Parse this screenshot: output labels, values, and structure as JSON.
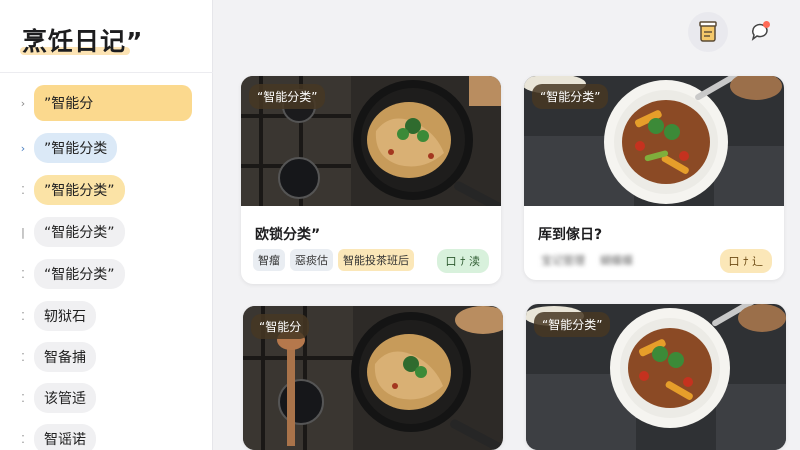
{
  "app": {
    "title": "烹饪日记”"
  },
  "sidebar": {
    "items": [
      {
        "label": "”智能分",
        "chev": "›",
        "style": "active"
      },
      {
        "label": "”智能分类",
        "chev": "›",
        "style": "blue"
      },
      {
        "label": "”智能分类”",
        "chev": "⁚",
        "style": "yellow"
      },
      {
        "label": "“智能分类”",
        "chev": "|",
        "style": "plain"
      },
      {
        "label": "“智能分类”",
        "chev": "⁚",
        "style": "plain"
      },
      {
        "label": "轫狱石",
        "chev": "⁚",
        "style": "plain"
      },
      {
        "label": "智备捕",
        "chev": "⁚",
        "style": "plain"
      },
      {
        "label": "该管适",
        "chev": "⁚",
        "style": "plain"
      },
      {
        "label": "智谣诺",
        "chev": "⁚",
        "style": "plain"
      }
    ]
  },
  "toolbar": {
    "jar_icon": "jar-icon",
    "chat_icon": "chat-bubble-icon",
    "notification_color": "#ff6b57"
  },
  "cards": [
    {
      "tag": "“智能分类”",
      "title": "欧锁分类”",
      "chips": [
        "智瘤",
        "惡痰估",
        "智能投茶班后"
      ],
      "action": "口 ﾅ 渎",
      "action_style": "green",
      "image": "pan-pasta"
    },
    {
      "tag": "“智能分类”",
      "title": "厍到傢日?",
      "chips": [
        "宝记管理",
        "蝴蝶蝶"
      ],
      "action": "口 ﾅ 辶",
      "action_style": "warm",
      "image": "bowl-beef"
    },
    {
      "tag": "“智能分",
      "title": "",
      "chips": [],
      "action": "",
      "action_style": "green",
      "image": "pan-pasta"
    },
    {
      "tag": "“智能分类”",
      "title": "",
      "chips": [],
      "action": "",
      "action_style": "warm",
      "image": "bowl-beef"
    }
  ]
}
